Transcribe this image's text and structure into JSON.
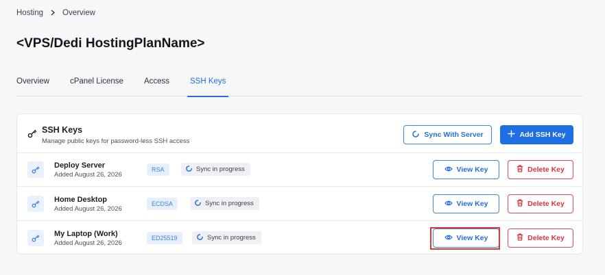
{
  "breadcrumb": {
    "root": "Hosting",
    "separator": ">",
    "current": "Overview"
  },
  "page_title": "<VPS/Dedi HostingPlanName>",
  "tabs": [
    {
      "label": "Overview"
    },
    {
      "label": "cPanel License"
    },
    {
      "label": "Access"
    },
    {
      "label": "SSH Keys",
      "active": true
    }
  ],
  "ssh_card": {
    "title": "SSH Keys",
    "subtitle": "Manage public keys for password-less SSH access",
    "sync_button": "Sync With Server",
    "add_button": "Add SSH Key",
    "rows": [
      {
        "name": "Deploy Server",
        "added": "Added August 26, 2026",
        "type": "RSA",
        "status": "Sync in progress",
        "view_label": "View Key",
        "delete_label": "Delete Key"
      },
      {
        "name": "Home Desktop",
        "added": "Added August 26, 2026",
        "type": "ECDSA",
        "status": "Sync in progress",
        "view_label": "View Key",
        "delete_label": "Delete Key"
      },
      {
        "name": "My Laptop (Work)",
        "added": "Added August 26, 2026",
        "type": "ED25519",
        "status": "Sync in progress",
        "view_label": "View Key",
        "delete_label": "Delete Key"
      }
    ]
  },
  "icons": {
    "key": "key-icon",
    "sync": "sync-icon",
    "plus": "plus-icon",
    "eye": "eye-icon",
    "trash": "trash-icon",
    "spinner": "spinner-icon"
  },
  "colors": {
    "accent": "#1e6fe3",
    "danger": "#d7333b",
    "highlight": "#d83a3a"
  }
}
